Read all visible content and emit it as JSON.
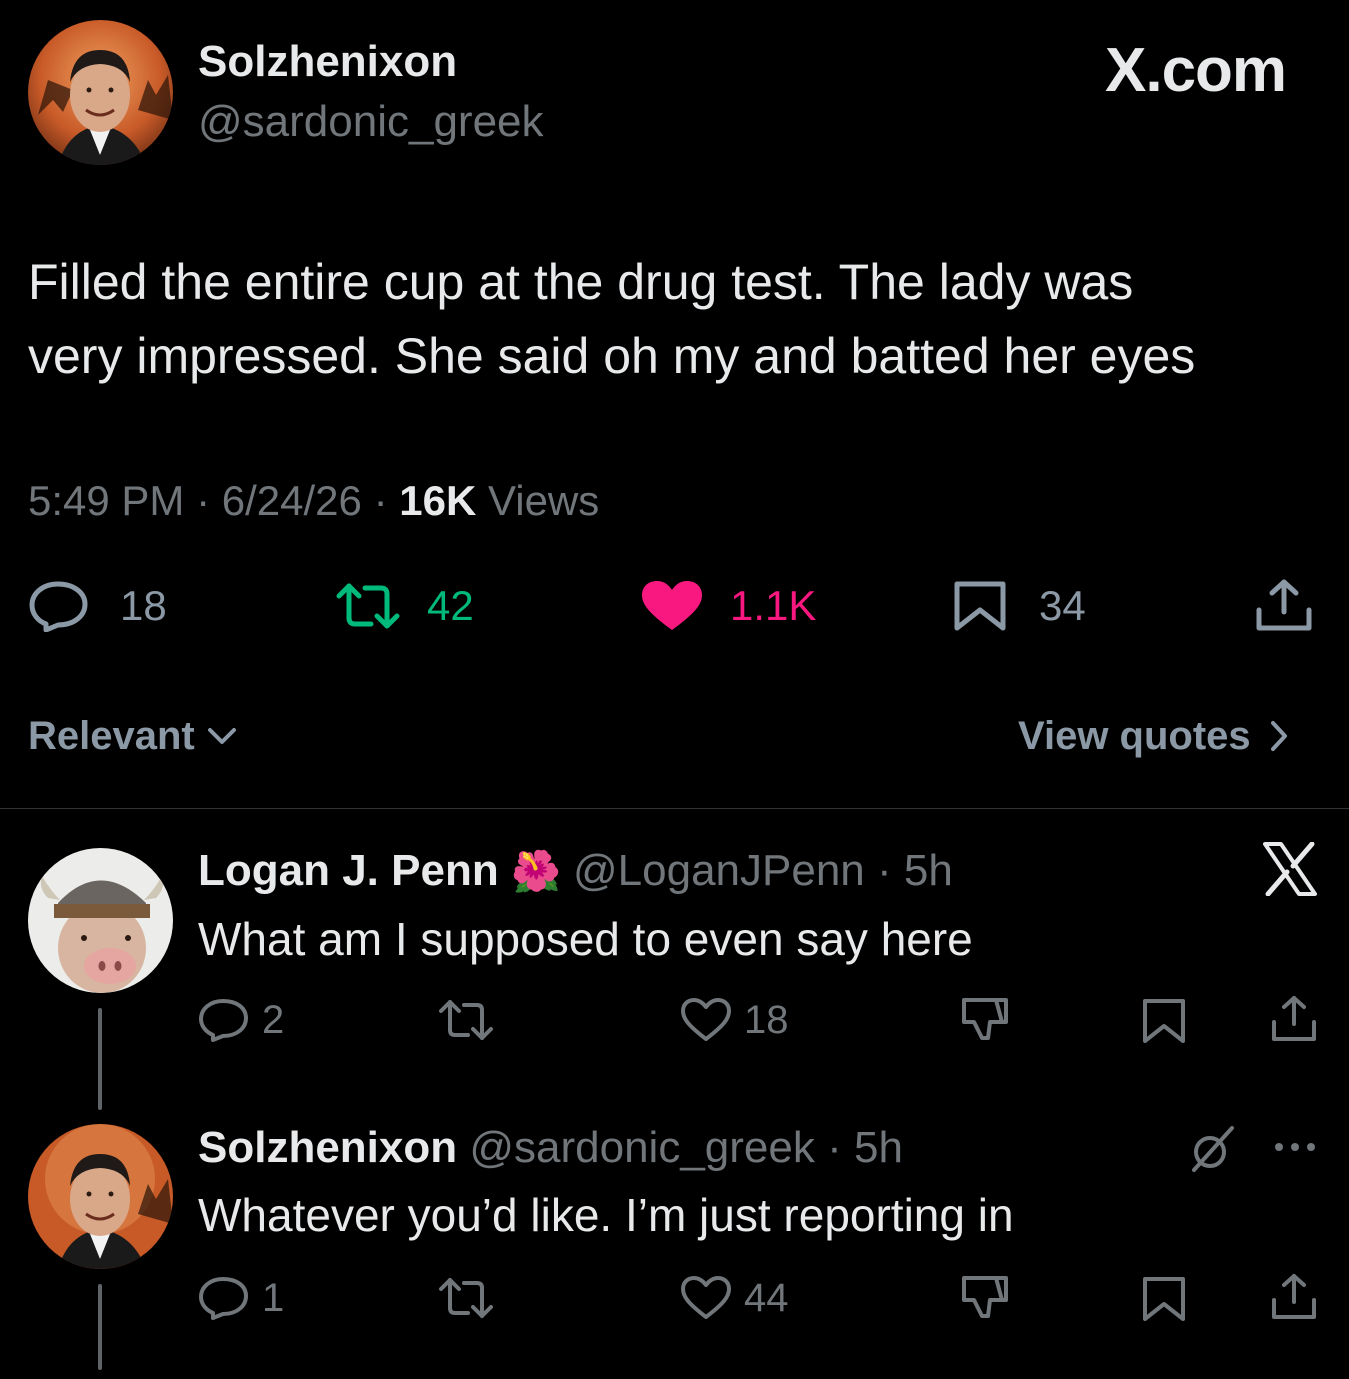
{
  "main_tweet": {
    "display_name": "Solzhenixon",
    "handle": "@sardonic_greek",
    "brand": "X.com",
    "text_line1": "Filled the entire cup at the drug test. The lady was",
    "text_line2": "very impressed. She said oh my and batted her eyes",
    "time": "5:49 PM",
    "sep1": "·",
    "date": "6/24/26",
    "sep2": "·",
    "views_count": "16K",
    "views_label": "Views",
    "stats": {
      "replies": "18",
      "reposts": "42",
      "likes": "1.1K",
      "bookmarks": "34"
    },
    "colors": {
      "repost": "#00ba7c",
      "like": "#f91880"
    }
  },
  "filters": {
    "sort_label": "Relevant",
    "view_quotes_label": "View quotes"
  },
  "replies": [
    {
      "display_name": "Logan J. Penn",
      "emoji": "🌺",
      "handle": "@LoganJPenn",
      "sep": "·",
      "time": "5h",
      "text": "What am I supposed to even say here",
      "replies": "2",
      "reposts": "",
      "likes": "18"
    },
    {
      "display_name": "Solzhenixon",
      "handle": "@sardonic_greek",
      "sep": "·",
      "time": "5h",
      "text": "Whatever you’d like. I’m just reporting in",
      "replies": "1",
      "reposts": "",
      "likes": "44"
    }
  ]
}
